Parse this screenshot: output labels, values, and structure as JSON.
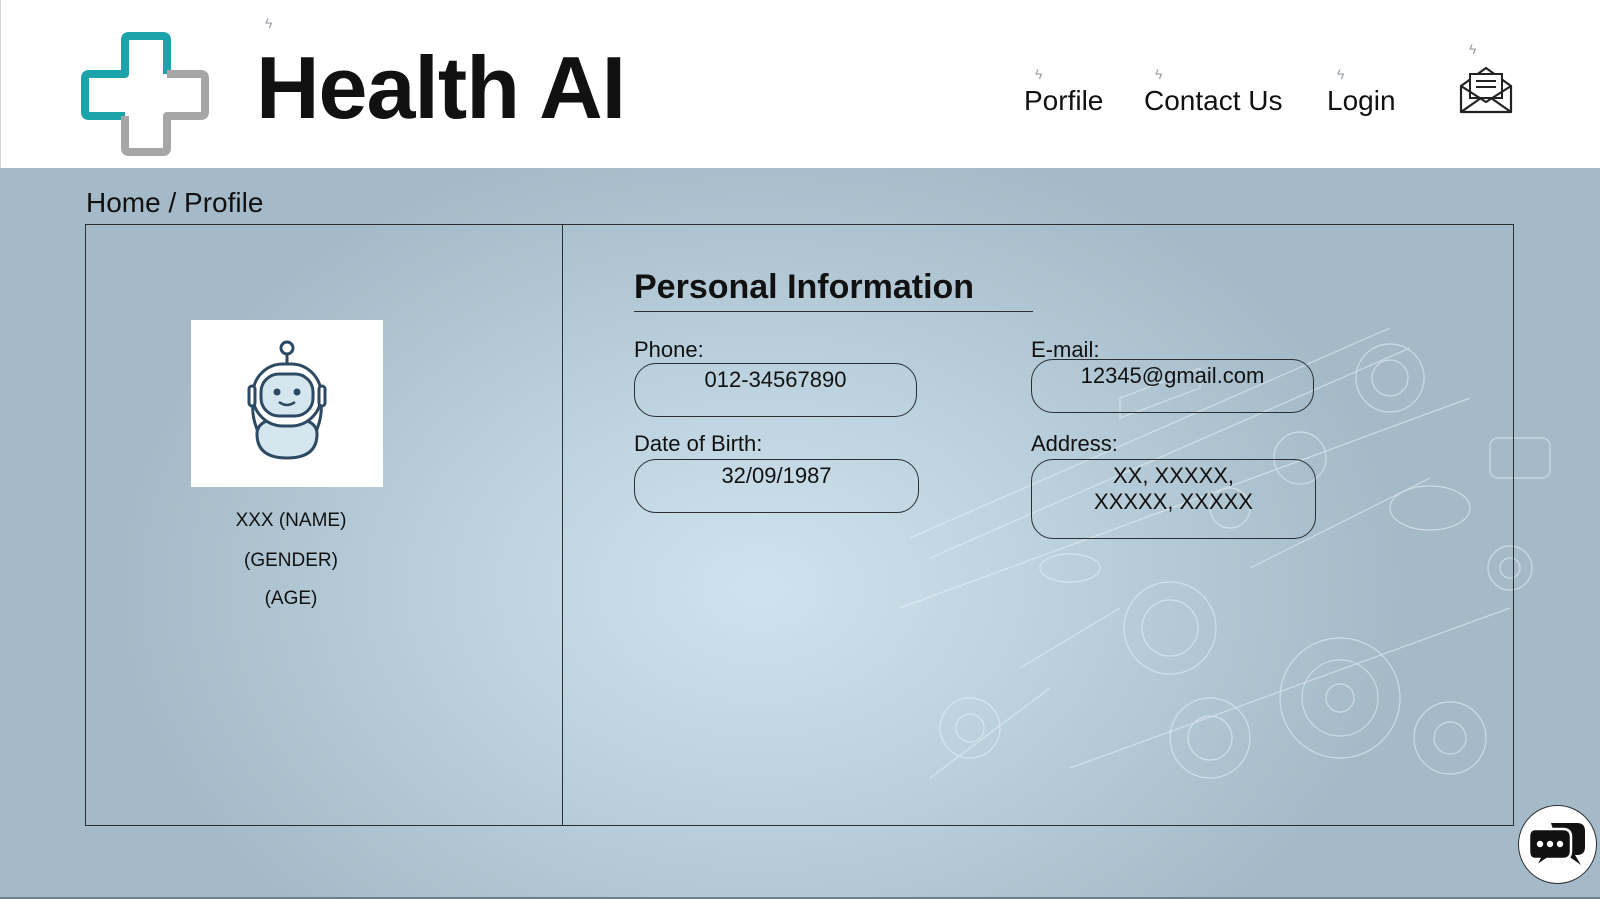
{
  "header": {
    "brand": "Health AI",
    "nav": [
      {
        "label": "Porfile"
      },
      {
        "label": "Contact Us"
      },
      {
        "label": "Login"
      }
    ],
    "icons": {
      "logo": "medical-cross-logo",
      "mail": "envelope-icon",
      "spark": "lightning-icon"
    }
  },
  "breadcrumb": "Home / Profile",
  "profile": {
    "avatar_icon": "robot-icon",
    "name": "XXX (NAME)",
    "gender": "(GENDER)",
    "age": "(AGE)"
  },
  "personal_info": {
    "title": "Personal Information",
    "phone_label": "Phone:",
    "phone": "012-34567890",
    "email_label": "E-mail:",
    "email": "12345@gmail.com",
    "dob_label": "Date of Birth:",
    "dob": "32/09/1987",
    "address_label": "Address:",
    "address_line1": "XX, XXXXX,",
    "address_line2": "XXXXX, XXXXX"
  },
  "chat": {
    "icon": "chat-bubbles-icon"
  },
  "colors": {
    "accent": "#1aa3a8",
    "background": "#a3b8c6",
    "header": "#ffffff"
  }
}
